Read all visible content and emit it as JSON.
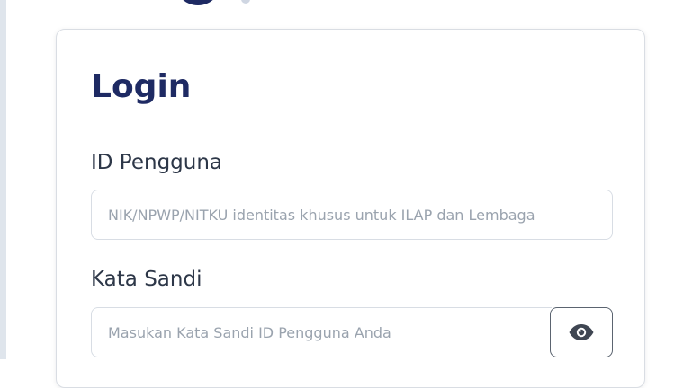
{
  "login": {
    "title": "Login",
    "user_label": "ID Pengguna",
    "user_placeholder": "NIK/NPWP/NITKU identitas khusus untuk ILAP dan Lembaga",
    "password_label": "Kata Sandi",
    "password_placeholder": "Masukan Kata Sandi ID Pengguna Anda"
  },
  "icons": {
    "password_toggle": "eye-icon"
  },
  "colors": {
    "title": "#1e2a63",
    "border": "#d8dde4",
    "toggle_border": "#5b6470"
  }
}
